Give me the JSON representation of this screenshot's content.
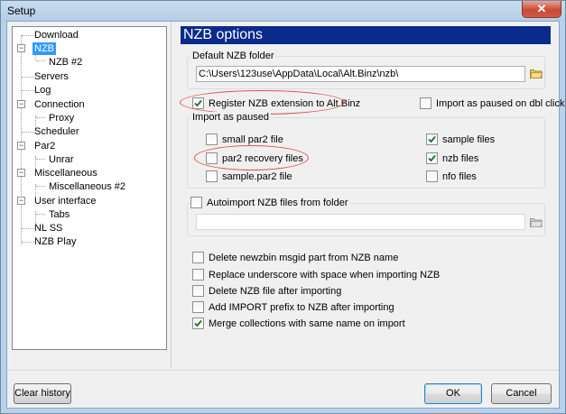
{
  "window": {
    "title": "Setup",
    "close_glyph": "✕"
  },
  "tree": {
    "items": [
      {
        "label": "Download"
      },
      {
        "label": "NZB",
        "selected": true
      },
      {
        "label": "NZB #2"
      },
      {
        "label": "Servers"
      },
      {
        "label": "Log"
      },
      {
        "label": "Connection"
      },
      {
        "label": "Proxy"
      },
      {
        "label": "Scheduler"
      },
      {
        "label": "Par2"
      },
      {
        "label": "Unrar"
      },
      {
        "label": "Miscellaneous"
      },
      {
        "label": "Miscellaneous #2"
      },
      {
        "label": "User interface"
      },
      {
        "label": "Tabs"
      },
      {
        "label": "NL SS"
      },
      {
        "label": "NZB Play"
      }
    ],
    "expander": "−"
  },
  "panel": {
    "header": "NZB options",
    "default_folder": {
      "label": "Default NZB folder",
      "value": "C:\\Users\\123use\\AppData\\Local\\Alt.Binz\\nzb\\",
      "browse_icon": "folder-icon"
    },
    "register_ext": {
      "label": "Register NZB extension to Alt.Binz",
      "checked": true
    },
    "import_paused_dbl": {
      "label": "Import as paused on dbl click",
      "checked": false
    },
    "import_as_paused": {
      "label": "Import as paused",
      "items": [
        {
          "label": "small par2 file",
          "checked": false
        },
        {
          "label": "par2 recovery files",
          "checked": false
        },
        {
          "label": "sample.par2 file",
          "checked": false
        },
        {
          "label": "sample files",
          "checked": true
        },
        {
          "label": "nzb files",
          "checked": true
        },
        {
          "label": "nfo files",
          "checked": false
        }
      ]
    },
    "autoimport": {
      "label": "Autoimport NZB files from folder",
      "checked": false,
      "value": "",
      "browse_icon": "folder-icon"
    },
    "options": [
      {
        "label": "Delete newzbin msgid part from NZB name",
        "checked": false
      },
      {
        "label": "Replace underscore with space when importing NZB",
        "checked": false
      },
      {
        "label": "Delete NZB file after importing",
        "checked": false
      },
      {
        "label": "Add IMPORT prefix to NZB after importing",
        "checked": false
      },
      {
        "label": "Merge collections with same name on import",
        "checked": true
      }
    ]
  },
  "buttons": {
    "clear_history": "Clear history",
    "ok": "OK",
    "cancel": "Cancel"
  },
  "colors": {
    "header_bg": "#0a2a8c",
    "selection": "#3399ff",
    "annotation_circle": "#e0504a"
  }
}
